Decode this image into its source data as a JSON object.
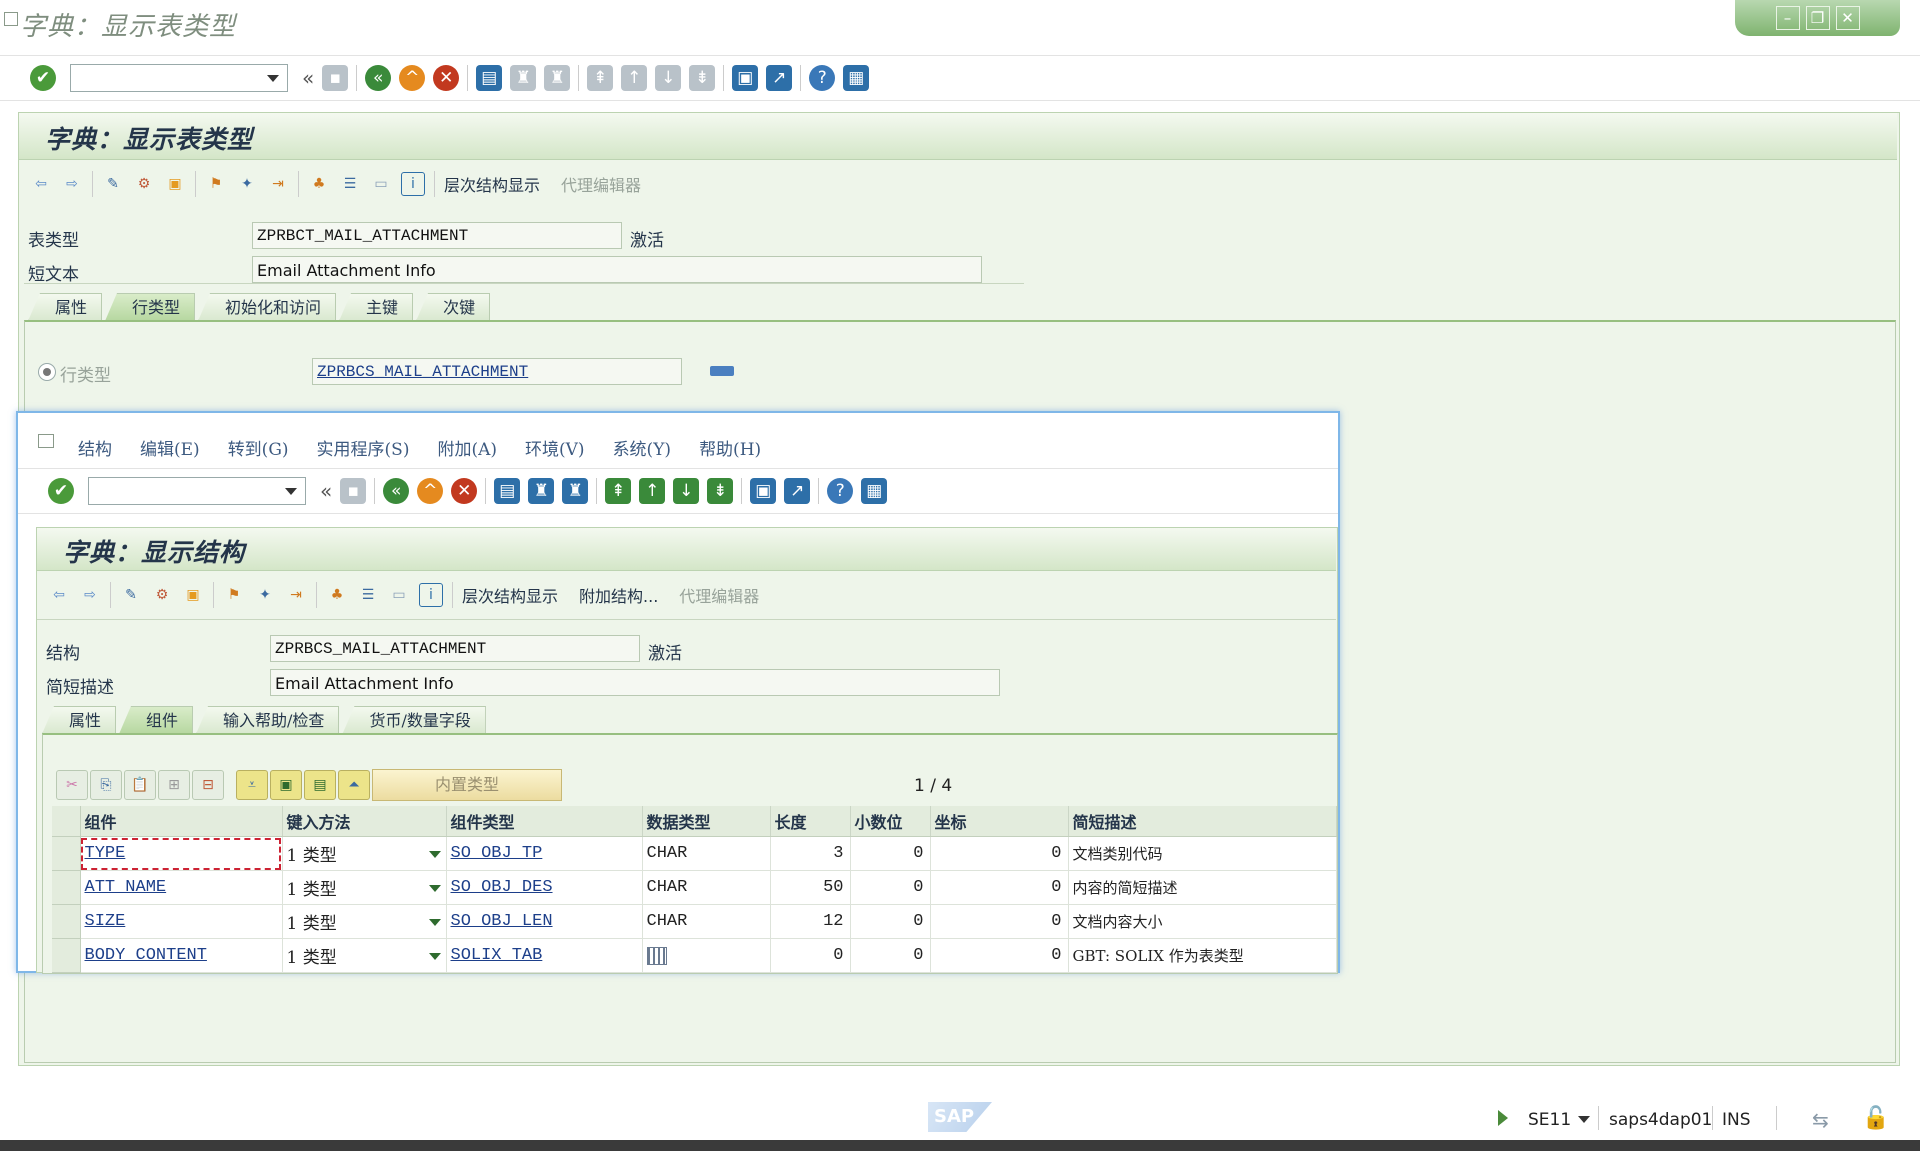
{
  "outer": {
    "window_title": "字典：显示表类型",
    "screen_title": "字典：显示表类型",
    "toolbar_text_hierarchy": "层次结构显示",
    "toolbar_text_proxy": "代理编辑器",
    "table_type_label": "表类型",
    "table_type_value": "ZPRBCT_MAIL_ATTACHMENT",
    "table_type_status": "激活",
    "short_text_label": "短文本",
    "short_text_value": "Email Attachment Info",
    "tabs": [
      "属性",
      "行类型",
      "初始化和访问",
      "主键",
      "次键"
    ],
    "row_type_radio_label": "行类型",
    "row_type_value": "ZPRBCS_MAIL_ATTACHMENT"
  },
  "inner": {
    "menu": [
      "结构",
      "编辑(E)",
      "转到(G)",
      "实用程序(S)",
      "附加(A)",
      "环境(V)",
      "系统(Y)",
      "帮助(H)"
    ],
    "screen_title": "字典：显示结构",
    "toolbar_text_hierarchy": "层次结构显示",
    "toolbar_text_append": "附加结构...",
    "toolbar_text_proxy": "代理编辑器",
    "structure_label": "结构",
    "structure_value": "ZPRBCS_MAIL_ATTACHMENT",
    "structure_status": "激活",
    "desc_label": "简短描述",
    "desc_value": "Email Attachment Info",
    "tabs": [
      "属性",
      "组件",
      "输入帮助/检查",
      "货币/数量字段"
    ],
    "builtin_type_button": "内置类型",
    "pager": "1 / 4",
    "columns": [
      "组件",
      "键入方法",
      "组件类型",
      "数据类型",
      "长度",
      "小数位",
      "坐标",
      "简短描述"
    ],
    "rows": [
      {
        "component": "TYPE",
        "typing": "1 类型",
        "comp_type": "SO_OBJ_TP",
        "data_type": "CHAR",
        "length": "3",
        "decimals": "0",
        "coord": "0",
        "desc": "文档类别代码"
      },
      {
        "component": "ATT_NAME",
        "typing": "1 类型",
        "comp_type": "SO_OBJ_DES",
        "data_type": "CHAR",
        "length": "50",
        "decimals": "0",
        "coord": "0",
        "desc": "内容的简短描述"
      },
      {
        "component": "SIZE",
        "typing": "1 类型",
        "comp_type": "SO_OBJ_LEN",
        "data_type": "CHAR",
        "length": "12",
        "decimals": "0",
        "coord": "0",
        "desc": "文档内容大小"
      },
      {
        "component": "BODY_CONTENT",
        "typing": "1 类型",
        "comp_type": "SOLIX_TAB",
        "data_type": "",
        "length": "0",
        "decimals": "0",
        "coord": "0",
        "desc": "GBT: SOLIX 作为表类型"
      }
    ]
  },
  "status": {
    "tcode": "SE11",
    "server": "saps4dap01",
    "mode": "INS"
  }
}
